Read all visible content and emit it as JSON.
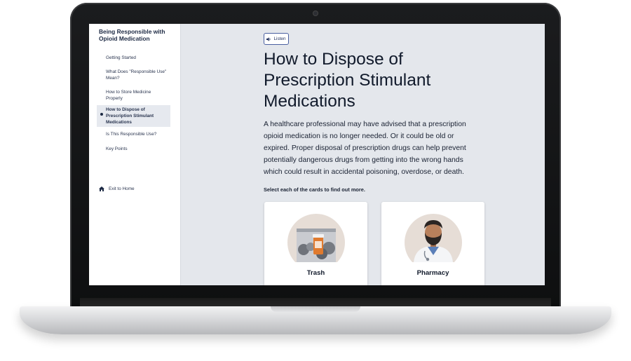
{
  "sidebar": {
    "course_title": "Being Responsible with Opioid Medication",
    "items": [
      {
        "label": "Getting Started",
        "active": false
      },
      {
        "label": "What Does \"Responsible Use\" Mean?",
        "active": false
      },
      {
        "label": "How to Store Medicine Properly",
        "active": false
      },
      {
        "label": "How to Dispose of Prescription Stimulant Medications",
        "active": true
      },
      {
        "label": "Is This Responsible Use?",
        "active": false
      },
      {
        "label": "Key Points",
        "active": false
      }
    ],
    "exit_label": "Exit to Home",
    "exit_icon": "home-icon"
  },
  "main": {
    "listen_label": "Listen",
    "listen_icon": "speaker-icon",
    "title": "How to Dispose of Prescription Stimulant Medications",
    "body": "A healthcare professional may have advised that a prescription opioid medication is no longer needed. Or it could be old or expired. Proper disposal of prescription drugs can help prevent potentially dangerous drugs from getting into the wrong hands which could result in accidental poisoning, overdose, or death.",
    "instruction": "Select each of the cards to find out more.",
    "cards": [
      {
        "label": "Trash",
        "icon": "trash-pill-bottle-illustration"
      },
      {
        "label": "Pharmacy",
        "icon": "pharmacist-illustration"
      }
    ]
  },
  "colors": {
    "sidebar_bg": "#ffffff",
    "content_bg": "#e4e7ec",
    "active_item_bg": "#e6e9ef",
    "text_primary": "#111a2b",
    "accent_border": "#4a5fa0"
  }
}
